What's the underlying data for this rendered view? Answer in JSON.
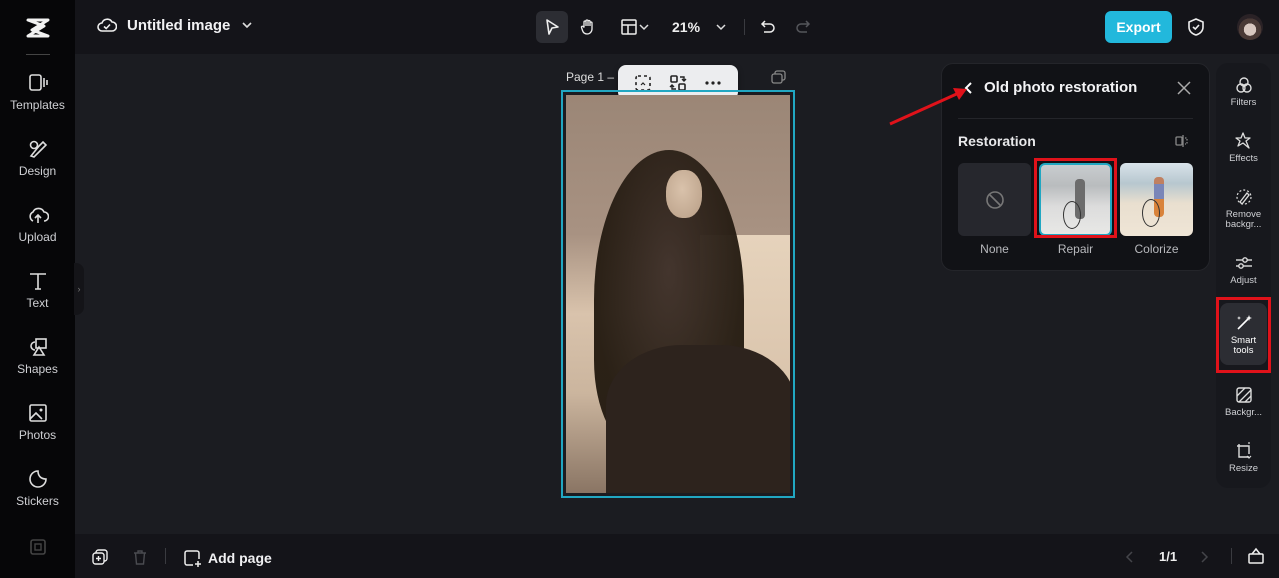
{
  "app": {
    "logo": "capcut-logo",
    "document_title": "Untitled image",
    "zoom_level": "21%",
    "export_label": "Export"
  },
  "left_nav": {
    "items": [
      {
        "label": "Templates",
        "icon": "templates-icon"
      },
      {
        "label": "Design",
        "icon": "design-icon"
      },
      {
        "label": "Upload",
        "icon": "upload-icon"
      },
      {
        "label": "Text",
        "icon": "text-icon"
      },
      {
        "label": "Shapes",
        "icon": "shapes-icon"
      },
      {
        "label": "Photos",
        "icon": "photos-icon"
      },
      {
        "label": "Stickers",
        "icon": "stickers-icon"
      }
    ]
  },
  "canvas": {
    "page_label": "Page 1 –",
    "image_description": "Sepia portrait of a seated woman with very long hair"
  },
  "restoration_panel": {
    "title": "Old photo restoration",
    "section_title": "Restoration",
    "options": [
      {
        "label": "None",
        "selected": false
      },
      {
        "label": "Repair",
        "selected": true
      },
      {
        "label": "Colorize",
        "selected": false
      }
    ]
  },
  "right_toolbar": {
    "items": [
      {
        "label": "Filters",
        "icon": "filters-icon"
      },
      {
        "label": "Effects",
        "icon": "effects-icon"
      },
      {
        "label": "Remove backgr...",
        "icon": "remove-background-icon"
      },
      {
        "label": "Adjust",
        "icon": "adjust-icon"
      },
      {
        "label": "Smart tools",
        "icon": "smart-tools-icon",
        "active": true
      },
      {
        "label": "Backgr...",
        "icon": "background-icon"
      },
      {
        "label": "Resize",
        "icon": "resize-icon"
      }
    ]
  },
  "bottom_bar": {
    "add_page_label": "Add page",
    "page_indicator": "1/1"
  },
  "colors": {
    "accent": "#22b8dc",
    "selection_border": "#21a7c2",
    "annotation_red": "#e0121a"
  }
}
